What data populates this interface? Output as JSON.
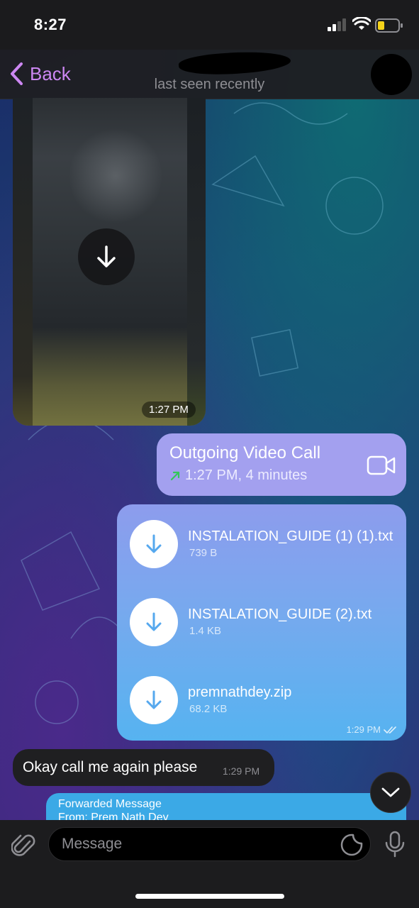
{
  "status_bar": {
    "time": "8:27"
  },
  "header": {
    "back_label": "Back",
    "status": "last seen recently"
  },
  "messages": {
    "video": {
      "time": "1:27 PM"
    },
    "call": {
      "title": "Outgoing Video Call",
      "detail": "1:27 PM, 4 minutes"
    },
    "files": {
      "items": [
        {
          "name": "INSTALATION_GUIDE (1) (1).txt",
          "size": "739 B"
        },
        {
          "name": "INSTALATION_GUIDE (2).txt",
          "size": "1.4 KB"
        },
        {
          "name": "premnathdey.zip",
          "size": "68.2 KB"
        }
      ],
      "time": "1:29 PM"
    },
    "incoming_text": {
      "text": "Okay call me again please",
      "time": "1:29 PM"
    },
    "forwarded": {
      "label": "Forwarded Message",
      "from": "From: Prem Nath Dey"
    }
  },
  "composer": {
    "placeholder": "Message"
  },
  "colors": {
    "accent": "#cc87f2",
    "call_bubble": "#a3a0ef",
    "files_bubble_top": "#8d9ced",
    "files_bubble_bottom": "#56b3f0",
    "forward_bubble": "#3ba9e6",
    "incoming_bubble": "#1f1f21",
    "battery_level": "#f5d31a",
    "call_arrow": "#34c759"
  },
  "icons": {
    "status": [
      "signal-icon",
      "wifi-icon",
      "battery-icon"
    ],
    "header": [
      "back-chevron-icon"
    ],
    "messages": [
      "download-icon",
      "video-camera-icon",
      "outgoing-arrow-icon",
      "read-checks-icon",
      "chevron-down-icon"
    ],
    "composer": [
      "paperclip-icon",
      "sticker-icon",
      "microphone-icon"
    ]
  }
}
